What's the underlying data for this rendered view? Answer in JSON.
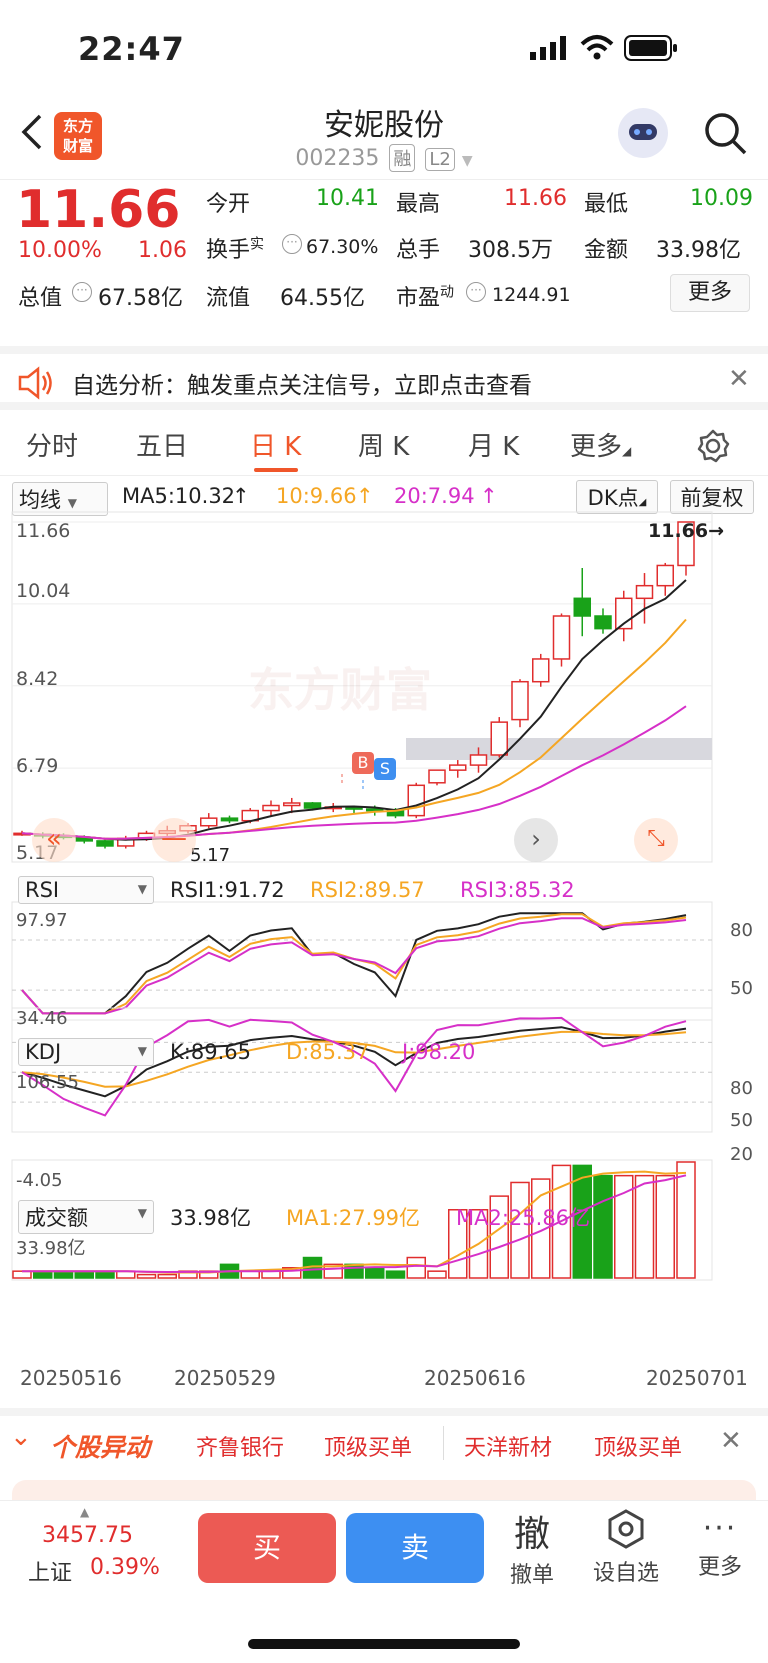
{
  "status": {
    "time": "22:47"
  },
  "header": {
    "name": "安妮股份",
    "code": "002235",
    "tag1": "融",
    "tag2": "L2",
    "logo_line1": "东方",
    "logo_line2": "财富"
  },
  "quote": {
    "price": "11.66",
    "change_pct": "10.00%",
    "change": "1.06",
    "open_label": "今开",
    "open": "10.41",
    "high_label": "最高",
    "high": "11.66",
    "low_label": "最低",
    "low": "10.09",
    "turnover_label": "换手",
    "turnover_sup": "实",
    "turnover": "67.30%",
    "volume_label": "总手",
    "volume": "308.5万",
    "amount_label": "金额",
    "amount": "33.98亿",
    "mktcap_label": "总值",
    "mktcap": "67.58亿",
    "float_label": "流值",
    "float": "64.55亿",
    "pe_label": "市盈",
    "pe_sup": "动",
    "pe": "1244.91",
    "more": "更多"
  },
  "notice": {
    "text": "自选分析：触发重点关注信号，立即点击查看"
  },
  "tabs": [
    "分时",
    "五日",
    "日 K",
    "周 K",
    "月 K",
    "更多"
  ],
  "active_tab": "日 K",
  "kline": {
    "selector": "均线",
    "ma5": "MA5:10.32",
    "ma10": "10:9.66",
    "ma20": "20:7.94",
    "dk_button": "DK点",
    "adjust_button": "前复权",
    "price_labels": [
      "11.66",
      "10.04",
      "8.42",
      "6.79",
      "5.17"
    ],
    "current_marker": "11.66→",
    "low_marker": "5.17",
    "watermark": "东方财富",
    "b_marker": "B",
    "s_marker": "S"
  },
  "rsi": {
    "selector": "RSI",
    "rsi1": "RSI1:91.72",
    "rsi2": "RSI2:89.57",
    "rsi3": "RSI3:85.32",
    "top": "97.97",
    "bottom": "34.46",
    "right_labels": [
      "80",
      "50"
    ]
  },
  "kdj": {
    "selector": "KDJ",
    "k": "K:89.65",
    "d": "D:85.37",
    "j": "J:98.20",
    "top": "106.55",
    "bottom": "-4.05",
    "right_labels": [
      "80",
      "50",
      "20"
    ]
  },
  "volume": {
    "selector": "成交额",
    "value": "33.98亿",
    "ma1": "MA1:27.99亿",
    "ma2": "MA2:25.86亿",
    "top": "33.98亿"
  },
  "dates": [
    "20250516",
    "20250529",
    "20250616",
    "20250701"
  ],
  "ticker": {
    "title": "个股异动",
    "items": [
      "齐鲁银行",
      "顶级买单",
      "天洋新材",
      "顶级买单"
    ]
  },
  "bottom": {
    "index_value": "3457.75",
    "index_name": "上证",
    "index_pct": "0.39%",
    "buy": "买",
    "sell": "卖",
    "cancel_glyph": "撤",
    "cancel": "撤单",
    "watchlist": "设自选",
    "more": "更多"
  },
  "colors": {
    "up": "#e02d2d",
    "down": "#19a219",
    "ma10": "#f5a623",
    "ma20": "#d630c8",
    "accent": "#f0562a"
  },
  "chart_data": {
    "type": "candlestick",
    "candles_ohlc": [
      [
        5.5,
        5.55,
        5.45,
        5.5
      ],
      [
        5.48,
        5.52,
        5.4,
        5.45
      ],
      [
        5.45,
        5.5,
        5.38,
        5.42
      ],
      [
        5.42,
        5.46,
        5.3,
        5.35
      ],
      [
        5.35,
        5.4,
        5.2,
        5.25
      ],
      [
        5.25,
        5.45,
        5.2,
        5.4
      ],
      [
        5.4,
        5.55,
        5.35,
        5.5
      ],
      [
        5.5,
        5.65,
        5.45,
        5.55
      ],
      [
        5.55,
        5.7,
        5.5,
        5.65
      ],
      [
        5.65,
        5.9,
        5.6,
        5.8
      ],
      [
        5.8,
        5.85,
        5.7,
        5.75
      ],
      [
        5.75,
        6.0,
        5.7,
        5.95
      ],
      [
        5.95,
        6.15,
        5.85,
        6.05
      ],
      [
        6.05,
        6.2,
        5.9,
        6.1
      ],
      [
        6.1,
        6.12,
        5.95,
        6.0
      ],
      [
        6.0,
        6.1,
        5.92,
        6.02
      ],
      [
        6.02,
        6.05,
        5.9,
        5.98
      ],
      [
        5.98,
        6.05,
        5.85,
        5.95
      ],
      [
        5.95,
        6.0,
        5.8,
        5.85
      ],
      [
        5.85,
        6.5,
        5.8,
        6.45
      ],
      [
        6.5,
        6.75,
        6.45,
        6.75
      ],
      [
        6.75,
        6.95,
        6.6,
        6.85
      ],
      [
        6.85,
        7.2,
        6.7,
        7.05
      ],
      [
        7.05,
        7.8,
        7.0,
        7.7
      ],
      [
        7.75,
        8.55,
        7.6,
        8.5
      ],
      [
        8.5,
        9.05,
        8.4,
        8.95
      ],
      [
        8.95,
        9.85,
        8.8,
        9.8
      ],
      [
        10.15,
        10.75,
        9.4,
        9.8
      ],
      [
        9.8,
        9.95,
        9.45,
        9.55
      ],
      [
        9.55,
        10.3,
        9.3,
        10.15
      ],
      [
        10.15,
        10.65,
        9.65,
        10.4
      ],
      [
        10.4,
        10.85,
        10.2,
        10.8
      ],
      [
        10.8,
        11.66,
        10.6,
        11.66
      ]
    ],
    "ma5": "10.32",
    "ma10": "9.66",
    "ma20": "7.94",
    "ylim": [
      5.17,
      11.66
    ]
  }
}
